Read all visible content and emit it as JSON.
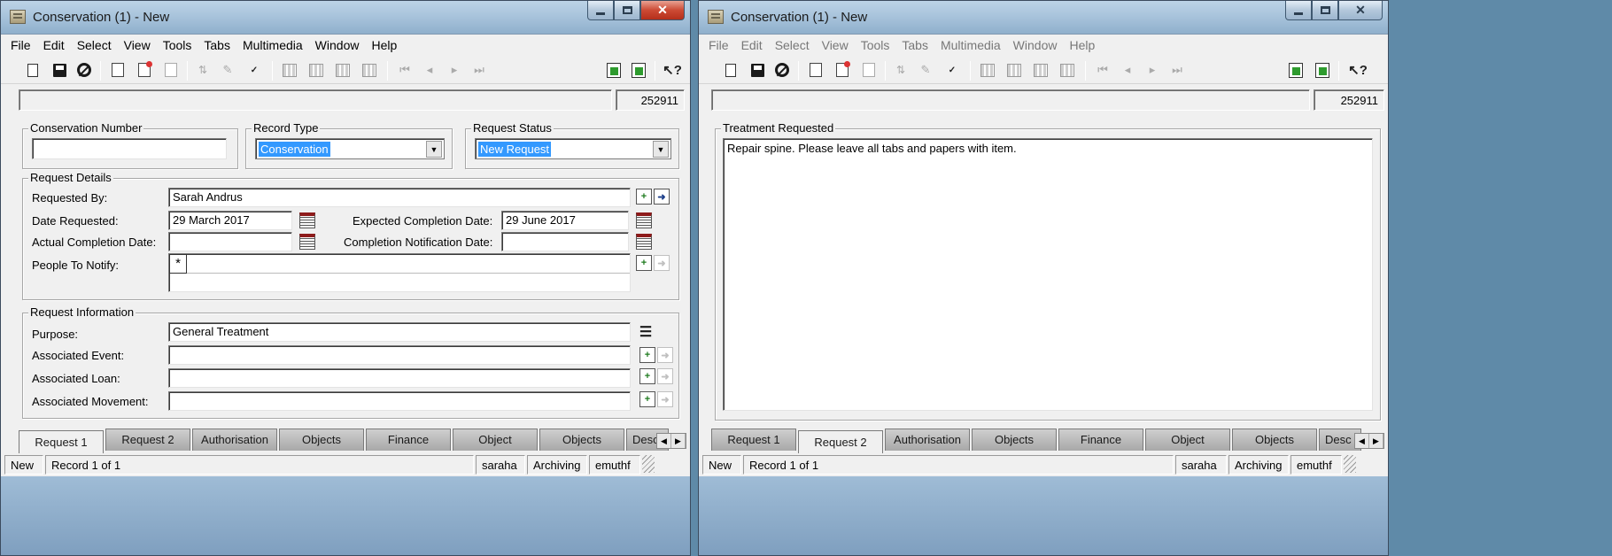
{
  "windows": [
    {
      "title": "Conservation (1) - New",
      "menu": [
        "File",
        "Edit",
        "Select",
        "View",
        "Tools",
        "Tabs",
        "Multimedia",
        "Window",
        "Help"
      ],
      "record_id": "252911",
      "groups": {
        "conservation_number": {
          "label": "Conservation Number",
          "value": ""
        },
        "record_type": {
          "label": "Record Type",
          "value": "Conservation"
        },
        "request_status": {
          "label": "Request Status",
          "value": "New Request"
        },
        "request_details": {
          "label": "Request Details",
          "requested_by_label": "Requested By:",
          "requested_by": "Sarah Andrus",
          "date_requested_label": "Date Requested:",
          "date_requested": "29 March 2017",
          "expected_label": "Expected Completion Date:",
          "expected": "29 June 2017",
          "actual_label": "Actual Completion Date:",
          "actual": "",
          "notification_label": "Completion Notification Date:",
          "notification": "",
          "people_label": "People To Notify:",
          "people_marker": "*"
        },
        "request_information": {
          "label": "Request Information",
          "purpose_label": "Purpose:",
          "purpose": "General Treatment",
          "event_label": "Associated Event:",
          "event": "",
          "loan_label": "Associated Loan:",
          "loan": "",
          "movement_label": "Associated Movement:",
          "movement": ""
        }
      },
      "tabs": [
        "Request 1",
        "Request 2",
        "Authorisation",
        "Objects",
        "Finance",
        "Object",
        "Objects",
        "Desc"
      ],
      "active_tab": "Request 1",
      "status": [
        "New",
        "Record 1 of 1",
        "saraha",
        "Archiving",
        "emuthf"
      ]
    },
    {
      "title": "Conservation (1) - New",
      "menu": [
        "File",
        "Edit",
        "Select",
        "View",
        "Tools",
        "Tabs",
        "Multimedia",
        "Window",
        "Help"
      ],
      "record_id": "252911",
      "treatment": {
        "label": "Treatment Requested",
        "value": "Repair spine. Please leave all tabs and papers with item."
      },
      "tabs": [
        "Request 1",
        "Request 2",
        "Authorisation",
        "Objects",
        "Finance",
        "Object",
        "Objects",
        "Desc"
      ],
      "active_tab": "Request 2",
      "status": [
        "New",
        "Record 1 of 1",
        "saraha",
        "Archiving",
        "emuthf"
      ]
    }
  ],
  "icons": {
    "toolbar": [
      "new-page-icon",
      "save-icon",
      "cancel-icon",
      "doc-icon",
      "doc-red-icon",
      "doc-empty-icon",
      "sort-icon",
      "edit-icon",
      "spellcheck-icon",
      "grid-icon",
      "grid-icon",
      "grid-icon",
      "grid-icon",
      "first-icon",
      "prev-icon",
      "next-icon",
      "last-icon",
      "green-doc-icon",
      "green-doc-icon",
      "help-icon"
    ]
  },
  "colors": {
    "selection": "#3399ff",
    "close_button": "#cc4a34",
    "titlebar": "#a9c4dc"
  }
}
